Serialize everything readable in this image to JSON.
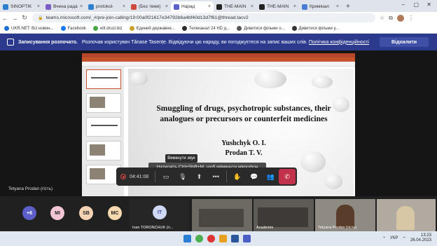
{
  "browser": {
    "tabs": [
      {
        "label": "SINOPTIK",
        "color": "#2f7fd1"
      },
      {
        "label": "Вчена рада",
        "color": "#7b5cc4"
      },
      {
        "label": "protokol-",
        "color": "#2f7fd1"
      },
      {
        "label": "(Без теми)",
        "color": "#d04a3c"
      },
      {
        "label": "Нарад",
        "color": "#5b5fc7",
        "active": true
      },
      {
        "label": "THE-MAIN",
        "color": "#222222"
      },
      {
        "label": "THE-MAIN",
        "color": "#222222"
      },
      {
        "label": "Кримінал",
        "color": "#4a7ed4"
      }
    ],
    "tab_close": "×",
    "new_tab": "+",
    "window_controls": {
      "minimize": "–",
      "maximize": "▢",
      "close": "✕"
    },
    "url": "teams.microsoft.com/_#/pre-join-calling/19:00a0f21617e34792b6a4bf40d13d7f61@thread.tacv2",
    "bookmarks": [
      {
        "label": "UKR.NET: Всі новин...",
        "color": "#1d6fd1"
      },
      {
        "label": "Facebook",
        "color": "#1877f2"
      },
      {
        "label": "elit.druzi.biz",
        "color": "#45a845"
      },
      {
        "label": "Єдиний державне...",
        "color": "#c9a227"
      },
      {
        "label": "Телеканал 24 HD д...",
        "color": "#2b2b2b"
      },
      {
        "label": "Дивитися фільми о...",
        "color": "#555555"
      },
      {
        "label": "Дивитися фільми у...",
        "color": "#333333"
      }
    ]
  },
  "banner": {
    "title": "Записування розпочато.",
    "text": "Розпочав користувач Tănase Tasențe. Відвідуючи цю нараду, ви погоджуєтеся на запис ваших слів.",
    "link": "Політика конфіденційності",
    "decline": "Відхилити"
  },
  "slide": {
    "title": "Smuggling of drugs, psychotropic substances, their analogues or precursors or counterfeit medicines",
    "author1": "Yushchyk O. I.",
    "author2": "Prodan T. V."
  },
  "call": {
    "tooltip": "Вимкнути звук",
    "hint": "Натисніть Ctrl+Shift+M, щоб увімкнути мікрофон",
    "timer": "04:41:08",
    "self_name": "Tetyana Prodan (гість)"
  },
  "participants": {
    "overflow": "+6",
    "avatars": [
      {
        "initials": "MI",
        "color": "#f3c6d6"
      },
      {
        "initials": "SB",
        "color": "#f6d2b5"
      },
      {
        "initials": "MC",
        "color": "#f7d9b0"
      }
    ],
    "main_initials": "IT",
    "main_name": "Ivan TORONCHUK (гі...",
    "tile_names": [
      "Academie",
      "Tetyana Prodan (гість)"
    ]
  },
  "taskbar": {
    "lang": "УКР",
    "time": "13:23",
    "date": "26.04.2023"
  }
}
